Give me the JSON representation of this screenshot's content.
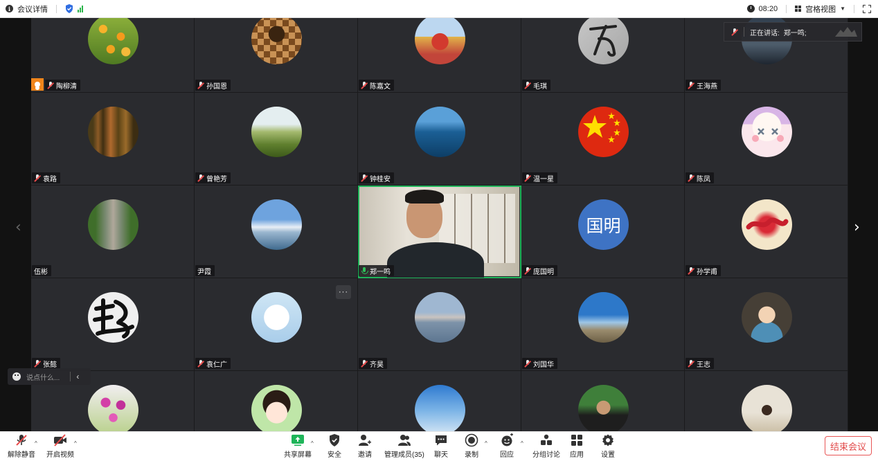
{
  "topbar": {
    "meeting_info": "会议详情",
    "time": "08:20",
    "view_mode": "宫格视图"
  },
  "speaking": {
    "label": "正在讲话:",
    "speaker": "郑一鸣;"
  },
  "participants": [
    {
      "name": "陶柳清",
      "row": 0,
      "col": 0,
      "avatar": "orange-flowers",
      "host": true,
      "muted": true
    },
    {
      "name": "孙国恩",
      "row": 0,
      "col": 1,
      "avatar": "chess-pieces",
      "muted": true
    },
    {
      "name": "陈嘉文",
      "row": 0,
      "col": 2,
      "avatar": "tiananmen-flowers",
      "muted": true
    },
    {
      "name": "毛琪",
      "row": 0,
      "col": 3,
      "avatar": "calligraphy-gray",
      "muted": true
    },
    {
      "name": "王海燕",
      "row": 0,
      "col": 4,
      "avatar": "dark-landscape",
      "muted": true
    },
    {
      "name": "袁路",
      "row": 1,
      "col": 0,
      "avatar": "autumn-forest",
      "muted": true
    },
    {
      "name": "曾艳芳",
      "row": 1,
      "col": 1,
      "avatar": "green-hills",
      "muted": true
    },
    {
      "name": "钟桂安",
      "row": 1,
      "col": 2,
      "avatar": "speedboat",
      "muted": true
    },
    {
      "name": "温一星",
      "row": 1,
      "col": 3,
      "avatar": "china-flag",
      "muted": true
    },
    {
      "name": "陈凤",
      "row": 1,
      "col": 4,
      "avatar": "cartoon-face",
      "muted": true
    },
    {
      "name": "伍彬",
      "row": 2,
      "col": 0,
      "avatar": "tree-road",
      "muted": false,
      "no_mic": true
    },
    {
      "name": "尹霞",
      "row": 2,
      "col": 1,
      "avatar": "opera-house",
      "muted": false,
      "no_mic": true
    },
    {
      "name": "郑一鸣",
      "row": 2,
      "col": 2,
      "avatar": "video",
      "muted": false,
      "active": true
    },
    {
      "name": "庞国明",
      "row": 2,
      "col": 3,
      "avatar": "text",
      "avatar_text": "国明",
      "muted": true
    },
    {
      "name": "孙学甫",
      "row": 2,
      "col": 4,
      "avatar": "red-calligraphy",
      "muted": true
    },
    {
      "name": "张懿",
      "row": 3,
      "col": 0,
      "avatar": "black-calligraphy",
      "muted": true
    },
    {
      "name": "袁仁广",
      "row": 3,
      "col": 1,
      "avatar": "panda-mascot",
      "muted": true,
      "more": true
    },
    {
      "name": "齐昊",
      "row": 3,
      "col": 2,
      "avatar": "lake-sunset",
      "muted": true
    },
    {
      "name": "刘国华",
      "row": 3,
      "col": 3,
      "avatar": "beach-sky",
      "muted": true
    },
    {
      "name": "王志",
      "row": 3,
      "col": 4,
      "avatar": "cartoon-man",
      "muted": true
    },
    {
      "name": "",
      "row": 4,
      "col": 0,
      "avatar": "pink-orchids"
    },
    {
      "name": "",
      "row": 4,
      "col": 1,
      "avatar": "cartoon-girl"
    },
    {
      "name": "",
      "row": 4,
      "col": 2,
      "avatar": "blue-sky"
    },
    {
      "name": "",
      "row": 4,
      "col": 3,
      "avatar": "man-photo"
    },
    {
      "name": "",
      "row": 4,
      "col": 4,
      "avatar": "woman-photo"
    }
  ],
  "more_label": "···",
  "chat": {
    "placeholder": "说点什么..."
  },
  "toolbar": {
    "unmute": "解除静音",
    "start_video": "开启视频",
    "share_screen": "共享屏幕",
    "security": "安全",
    "invite": "邀请",
    "manage_members": "管理成员(35)",
    "chat": "聊天",
    "record": "录制",
    "reactions": "回应",
    "breakout": "分组讨论",
    "apps": "应用",
    "settings": "设置",
    "end_meeting": "结束会议"
  },
  "colors": {
    "active_border": "#1fb55a",
    "host_badge": "#f0851b",
    "end_button": "#e24a4a",
    "share_green": "#1fb55a"
  }
}
